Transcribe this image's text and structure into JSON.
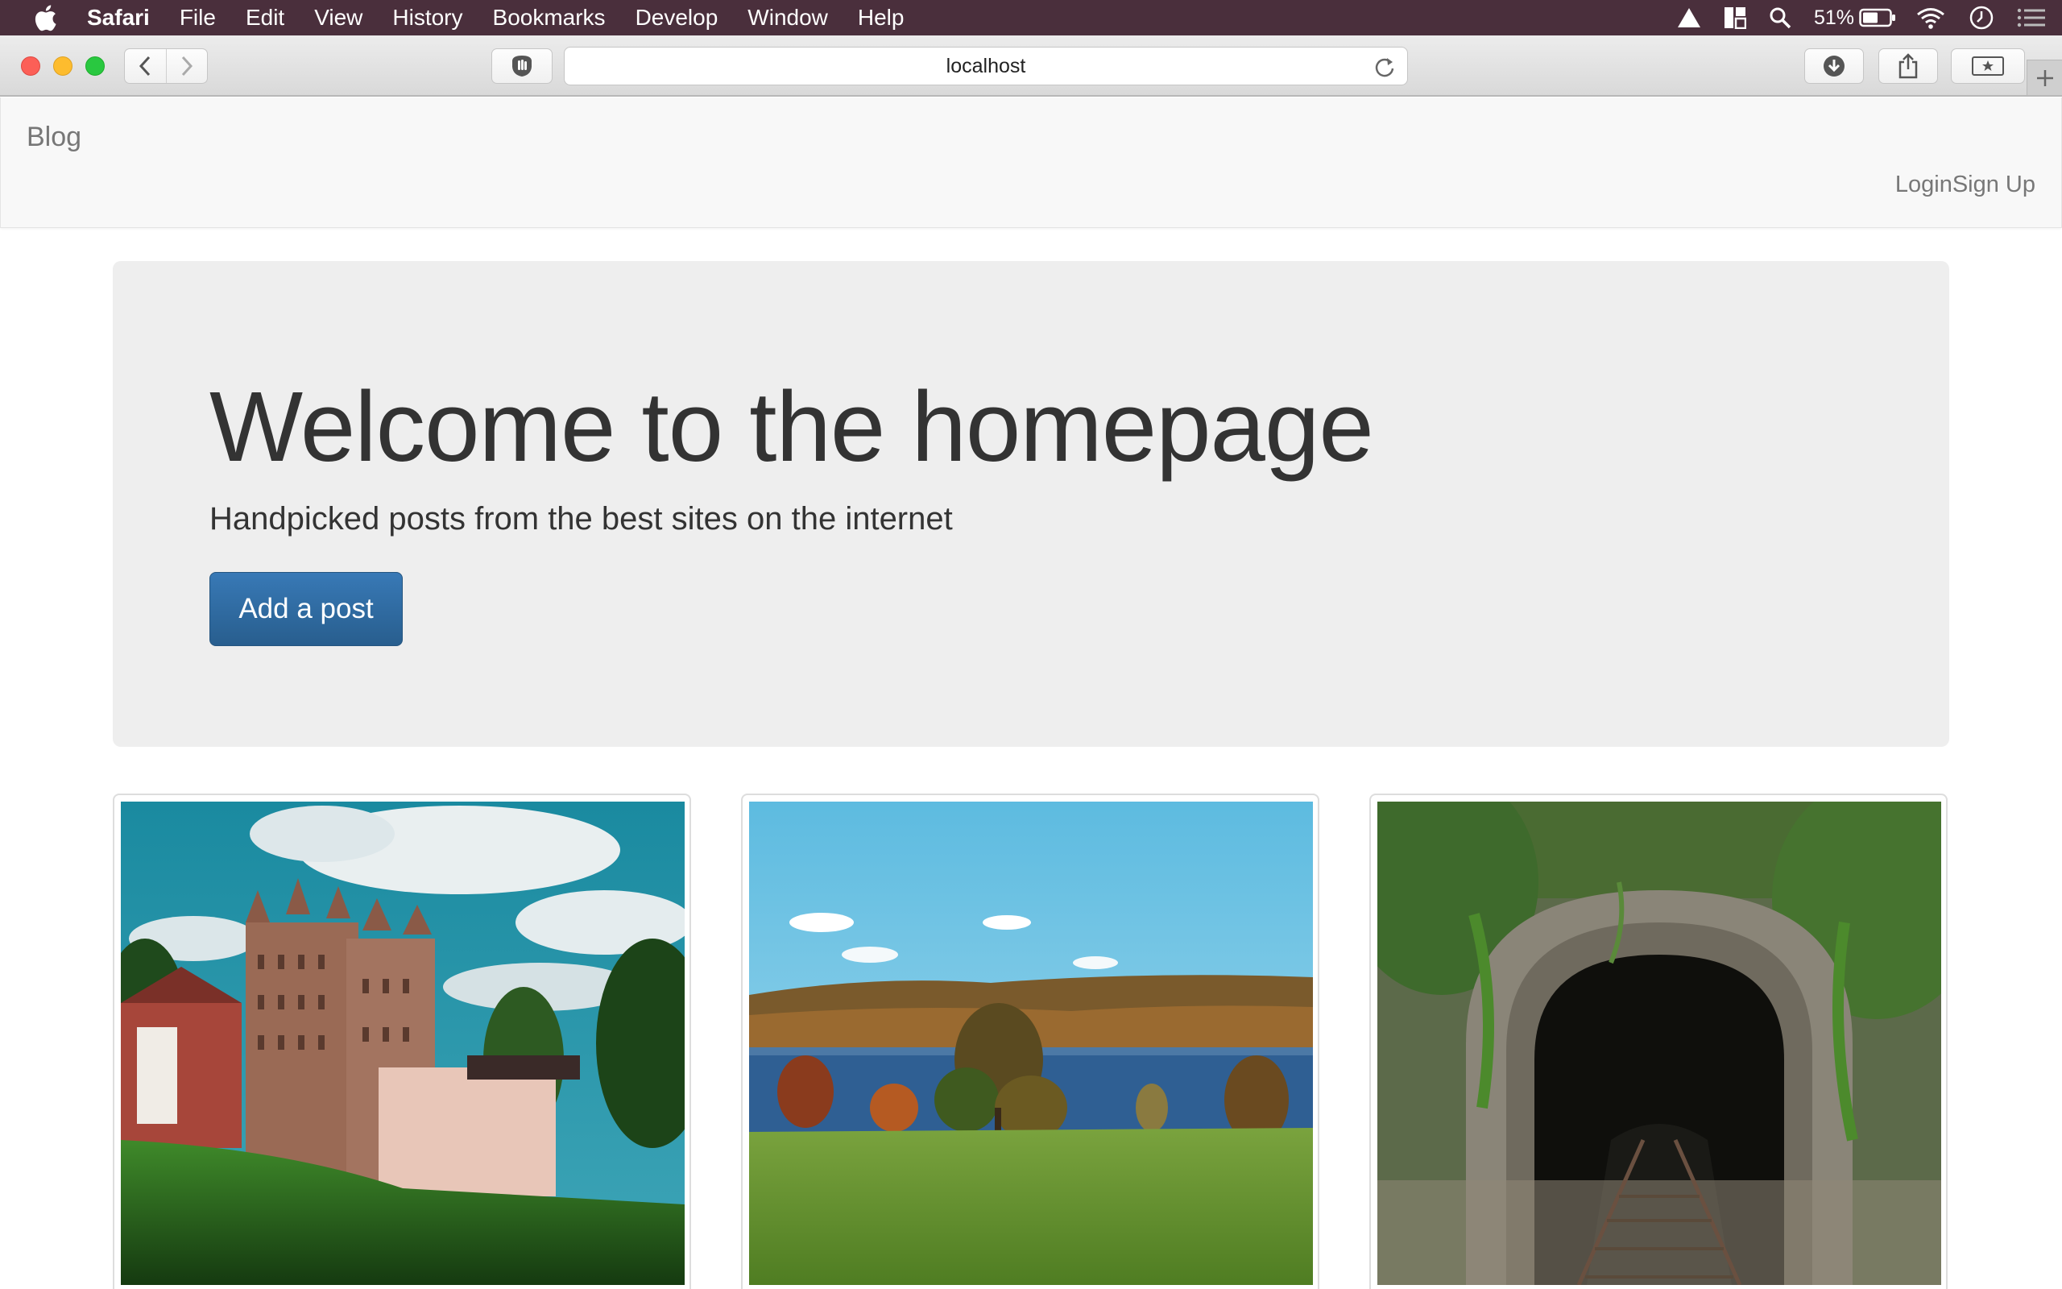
{
  "menubar": {
    "app_name": "Safari",
    "items": [
      "File",
      "Edit",
      "View",
      "History",
      "Bookmarks",
      "Develop",
      "Window",
      "Help"
    ],
    "battery_percent": "51%",
    "status_icons": [
      "drive-icon",
      "window-manager-icon",
      "search-icon",
      "battery-icon",
      "wifi-icon",
      "clock-icon",
      "notification-center-icon"
    ]
  },
  "browser": {
    "address": "localhost",
    "traffic_colors": {
      "close": "#fc5f57",
      "minimize": "#fdbc2e",
      "zoom": "#29c840"
    }
  },
  "page": {
    "brand": "Blog",
    "nav": {
      "login": "Login",
      "signup": "Sign Up"
    },
    "hero": {
      "title": "Welcome to the homepage",
      "lead": "Handpicked posts from the best sites on the internet",
      "button": "Add a post",
      "button_color": "#337ab7"
    },
    "thumbnails": [
      {
        "subject": "castle mansion on green lawn with cloudy sky"
      },
      {
        "subject": "lake with autumn trees and grassy meadow"
      },
      {
        "subject": "railway tunnel overgrown with vines"
      }
    ]
  }
}
